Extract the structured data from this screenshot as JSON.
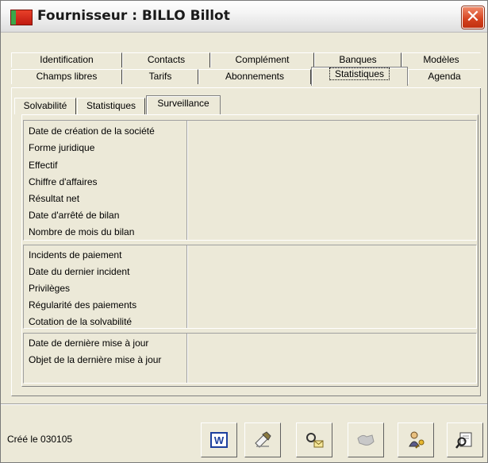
{
  "window": {
    "title": "Fournisseur : BILLO Billot",
    "close_glyph": "✕"
  },
  "tabs": {
    "row1": [
      "Identification",
      "Contacts",
      "Complément",
      "Banques",
      "Modèles"
    ],
    "row2": [
      "Champs libres",
      "Tarifs",
      "Abonnements",
      "Statistiques",
      "Agenda"
    ],
    "active": "Statistiques"
  },
  "subtabs": {
    "items": [
      "Solvabilité",
      "Statistiques",
      "Surveillance"
    ],
    "active": "Surveillance"
  },
  "sections": [
    {
      "labels": [
        "Date de création de la société",
        "Forme juridique",
        "Effectif",
        "Chiffre d'affaires",
        "Résultat net",
        "Date d'arrêté de bilan",
        "Nombre de mois du bilan"
      ]
    },
    {
      "labels": [
        "Incidents de paiement",
        "Date du dernier incident",
        "Privilèges",
        "Régularité des paiements",
        "Cotation de la solvabilité"
      ]
    },
    {
      "labels": [
        "Date de dernière mise à jour",
        "Objet de la dernière mise à jour"
      ]
    }
  ],
  "status": {
    "created": "Créé le 030105"
  },
  "toolbar": {
    "buttons": [
      {
        "icon": "word-icon"
      },
      {
        "icon": "pencil-note-icon"
      },
      {
        "icon": "search-mail-icon"
      },
      {
        "icon": "handshake-icon"
      },
      {
        "icon": "user-key-icon"
      },
      {
        "icon": "print-preview-icon"
      }
    ],
    "word_glyph": "W"
  },
  "colors": {
    "window_bg": "#ece9d8",
    "close_red": "#d4411e",
    "word_blue": "#1c3f9e"
  }
}
